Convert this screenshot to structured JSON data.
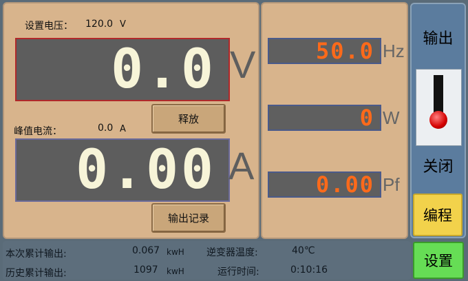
{
  "voltage": {
    "set_label": "设置电压：",
    "set_value": "120.0",
    "set_unit": "V",
    "display_value": "0.0",
    "unit": "V"
  },
  "current": {
    "peak_label": "峰值电流：",
    "peak_value": "0.0",
    "peak_unit": "A",
    "display_value": "0.00",
    "unit": "A"
  },
  "buttons": {
    "release": "释放",
    "output_log": "输出记录",
    "program": "编程",
    "settings": "设置"
  },
  "meters": {
    "frequency": {
      "value": "50.0",
      "unit": "Hz"
    },
    "power": {
      "value": "0",
      "unit": "W"
    },
    "power_factor": {
      "value": "0.00",
      "unit": "Pf"
    }
  },
  "output_switch": {
    "title": "输出",
    "state": "关闭"
  },
  "status": {
    "session_output_label": "本次累计输出:",
    "session_output_value": "0.067",
    "session_output_unit": "kwH",
    "total_output_label": "历史累计输出:",
    "total_output_value": "1097",
    "total_output_unit": "kwH",
    "inverter_temp_label": "逆变器温度:",
    "inverter_temp_value": "40℃",
    "run_time_label": "运行时间:",
    "run_time_value": "0:10:16"
  },
  "colors": {
    "panel": "#d8b48c",
    "display_bg": "#5d5d5d",
    "big_digits": "#f7f4d8",
    "small_digits": "#ff6a1a",
    "program_button": "#f2d24b",
    "settings_button": "#66dd55"
  }
}
